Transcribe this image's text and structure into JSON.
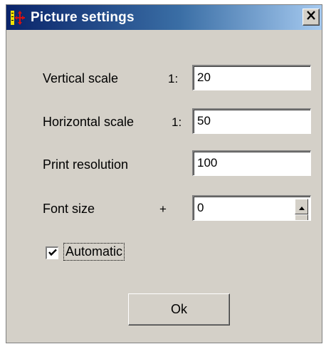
{
  "window": {
    "title": "Picture settings",
    "icon": "scale-arrows-icon",
    "close_icon": "close-icon"
  },
  "fields": {
    "vertical_scale": {
      "label": "Vertical scale",
      "prefix": "1:",
      "value": "20"
    },
    "horizontal_scale": {
      "label": "Horizontal scale",
      "prefix": "1:",
      "value": "50"
    },
    "print_resolution": {
      "label": "Print resolution",
      "value": "100"
    },
    "font_size": {
      "label": "Font size",
      "prefix": "+",
      "value": "0"
    }
  },
  "automatic": {
    "label": "Automatic",
    "checked": true
  },
  "ok_button": {
    "label": "Ok"
  },
  "colors": {
    "dialog_bg": "#d4d0c8",
    "titlebar_start": "#0a246a",
    "titlebar_end": "#a6caf0",
    "icon_red": "#d81010",
    "icon_yellow": "#f0e000"
  }
}
